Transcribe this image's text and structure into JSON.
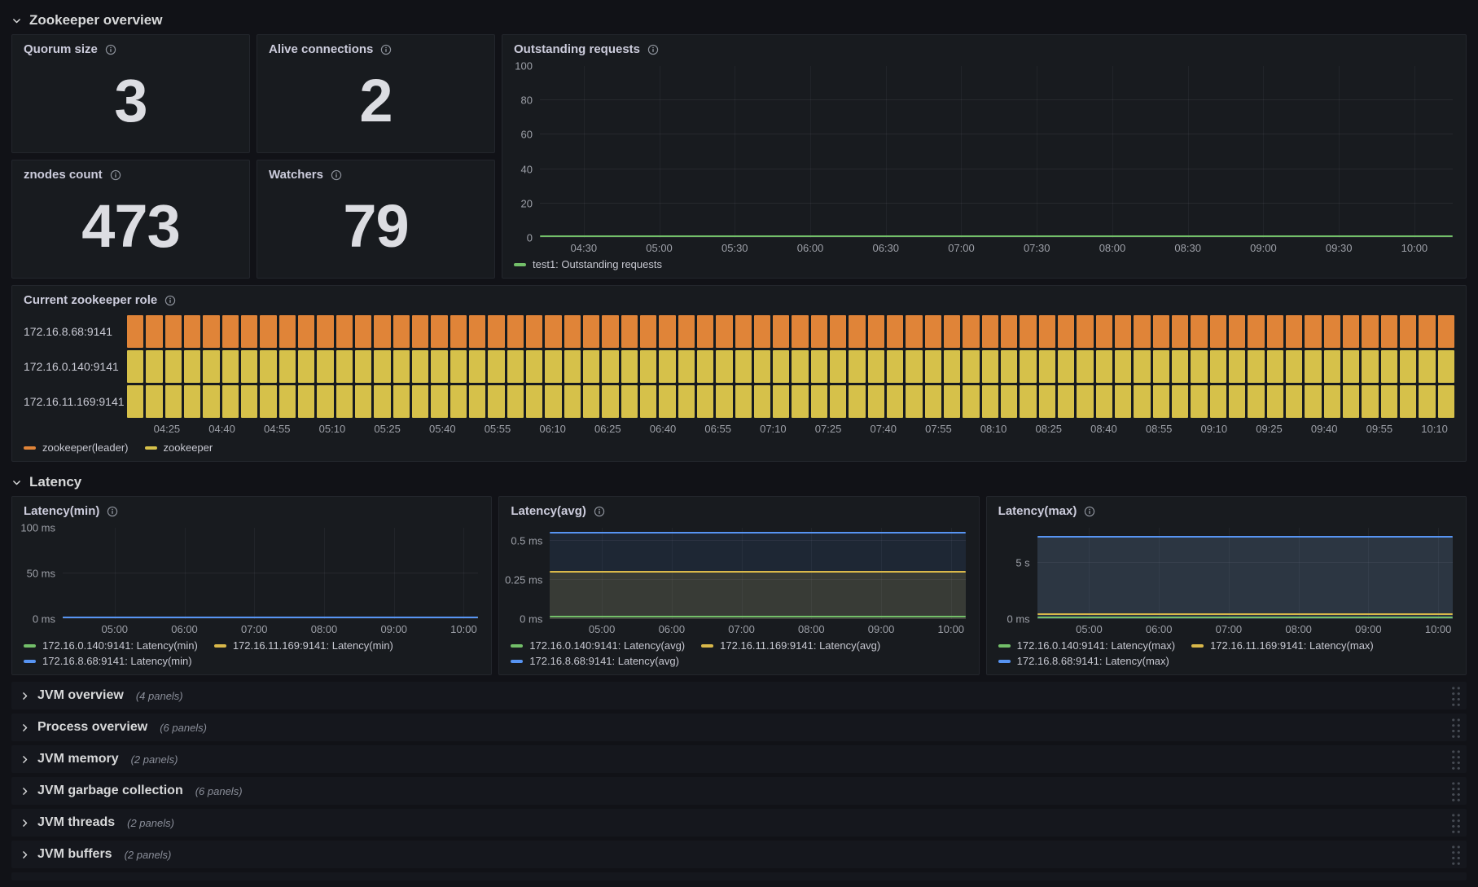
{
  "sections": {
    "zookeeper_overview": {
      "title": "Zookeeper overview"
    },
    "latency": {
      "title": "Latency"
    }
  },
  "stat_panels": [
    {
      "title": "Quorum size",
      "value": "3"
    },
    {
      "title": "Alive connections",
      "value": "2"
    },
    {
      "title": "znodes count",
      "value": "473"
    },
    {
      "title": "Watchers",
      "value": "79"
    }
  ],
  "outstanding_requests": {
    "title": "Outstanding requests",
    "chart": {
      "y_ticks": [
        {
          "label": "0",
          "frac": 0
        },
        {
          "label": "20",
          "frac": 0.2
        },
        {
          "label": "40",
          "frac": 0.4
        },
        {
          "label": "60",
          "frac": 0.6
        },
        {
          "label": "80",
          "frac": 0.8
        },
        {
          "label": "100",
          "frac": 1
        }
      ],
      "x_ticks": [
        "04:30",
        "05:00",
        "05:30",
        "06:00",
        "06:30",
        "07:00",
        "07:30",
        "08:00",
        "08:30",
        "09:00",
        "09:30",
        "10:00"
      ],
      "x_start_frac": 0.048,
      "x_end_frac": 0.958,
      "series": [
        {
          "name": "test1: Outstanding requests",
          "color": "#73bf69",
          "frac": 0.008
        }
      ]
    },
    "legend_rows": [
      [
        {
          "label": "test1: Outstanding requests",
          "color": "#73bf69"
        }
      ]
    ]
  },
  "zookeeper_role": {
    "title": "Current zookeeper role",
    "segments": 70,
    "rows": [
      {
        "label": "172.16.8.68:9141",
        "state": "zookeeper(leader)",
        "color": "#e08438"
      },
      {
        "label": "172.16.0.140:9141",
        "state": "zookeeper",
        "color": "#d6c14a"
      },
      {
        "label": "172.16.11.169:9141",
        "state": "zookeeper",
        "color": "#d6c14a"
      }
    ],
    "x_ticks": [
      "04:25",
      "04:40",
      "04:55",
      "05:10",
      "05:25",
      "05:40",
      "05:55",
      "06:10",
      "06:25",
      "06:40",
      "06:55",
      "07:10",
      "07:25",
      "07:40",
      "07:55",
      "08:10",
      "08:25",
      "08:40",
      "08:55",
      "09:10",
      "09:25",
      "09:40",
      "09:55",
      "10:10"
    ],
    "x_start_frac": 0.03,
    "x_end_frac": 0.985,
    "legend_rows": [
      [
        {
          "label": "zookeeper(leader)",
          "color": "#e08438"
        },
        {
          "label": "zookeeper",
          "color": "#d6c14a"
        }
      ]
    ]
  },
  "latency_min": {
    "title": "Latency(min)",
    "chart": {
      "y_ticks": [
        {
          "label": "0 ms",
          "frac": 0
        },
        {
          "label": "50 ms",
          "frac": 0.5
        },
        {
          "label": "100 ms",
          "frac": 1
        }
      ],
      "x_ticks": [
        "05:00",
        "06:00",
        "07:00",
        "08:00",
        "09:00",
        "10:00"
      ],
      "x_start_frac": 0.125,
      "x_end_frac": 0.965,
      "series": [
        {
          "name": "172.16.0.140:9141: Latency(min)",
          "color": "#73bf69",
          "frac": 0.018
        },
        {
          "name": "172.16.11.169:9141: Latency(min)",
          "color": "#d9b84a",
          "frac": 0.018
        },
        {
          "name": "172.16.8.68:9141: Latency(min)",
          "color": "#5794f2",
          "frac": 0.022
        }
      ]
    },
    "legend_rows": [
      [
        {
          "label": "172.16.0.140:9141: Latency(min)",
          "color": "#73bf69"
        },
        {
          "label": "172.16.11.169:9141: Latency(min)",
          "color": "#d9b84a"
        }
      ],
      [
        {
          "label": "172.16.8.68:9141: Latency(min)",
          "color": "#5794f2"
        }
      ]
    ]
  },
  "latency_avg": {
    "title": "Latency(avg)",
    "chart": {
      "y_ticks": [
        {
          "label": "0 ms",
          "frac": 0
        },
        {
          "label": "0.25 ms",
          "frac": 0.43
        },
        {
          "label": "0.5 ms",
          "frac": 0.86
        }
      ],
      "x_ticks": [
        "05:00",
        "06:00",
        "07:00",
        "08:00",
        "09:00",
        "10:00"
      ],
      "x_start_frac": 0.125,
      "x_end_frac": 0.965,
      "series": [
        {
          "name": "172.16.8.68:9141: Latency(avg)",
          "color": "#5794f2",
          "frac": 0.95,
          "fill_color": "rgba(87,148,242,0.10)"
        },
        {
          "name": "172.16.11.169:9141: Latency(avg)",
          "color": "#d9b84a",
          "frac": 0.52,
          "fill_color": "rgba(217,184,74,0.14)"
        },
        {
          "name": "172.16.0.140:9141: Latency(avg)",
          "color": "#73bf69",
          "frac": 0.025
        }
      ]
    },
    "legend_rows": [
      [
        {
          "label": "172.16.0.140:9141: Latency(avg)",
          "color": "#73bf69"
        },
        {
          "label": "172.16.11.169:9141: Latency(avg)",
          "color": "#d9b84a"
        }
      ],
      [
        {
          "label": "172.16.8.68:9141: Latency(avg)",
          "color": "#5794f2"
        }
      ]
    ]
  },
  "latency_max": {
    "title": "Latency(max)",
    "chart": {
      "y_ticks": [
        {
          "label": "0 ms",
          "frac": 0
        },
        {
          "label": "5 s",
          "frac": 0.62
        }
      ],
      "x_ticks": [
        "05:00",
        "06:00",
        "07:00",
        "08:00",
        "09:00",
        "10:00"
      ],
      "x_start_frac": 0.125,
      "x_end_frac": 0.965,
      "series": [
        {
          "name": "172.16.8.68:9141: Latency(max)",
          "color": "#5794f2",
          "frac": 0.9,
          "fill_color": "rgba(120,150,190,0.22)"
        },
        {
          "name": "172.16.11.169:9141: Latency(max)",
          "color": "#d9b84a",
          "frac": 0.05
        },
        {
          "name": "172.16.0.140:9141: Latency(max)",
          "color": "#73bf69",
          "frac": 0.015
        }
      ]
    },
    "legend_rows": [
      [
        {
          "label": "172.16.0.140:9141: Latency(max)",
          "color": "#73bf69"
        },
        {
          "label": "172.16.11.169:9141: Latency(max)",
          "color": "#d9b84a"
        }
      ],
      [
        {
          "label": "172.16.8.68:9141: Latency(max)",
          "color": "#5794f2"
        }
      ]
    ]
  },
  "collapsed_rows": [
    {
      "title": "JVM overview",
      "count": "(4 panels)"
    },
    {
      "title": "Process overview",
      "count": "(6 panels)"
    },
    {
      "title": "JVM memory",
      "count": "(2 panels)"
    },
    {
      "title": "JVM garbage collection",
      "count": "(6 panels)"
    },
    {
      "title": "JVM threads",
      "count": "(2 panels)"
    },
    {
      "title": "JVM buffers",
      "count": "(2 panels)"
    }
  ]
}
